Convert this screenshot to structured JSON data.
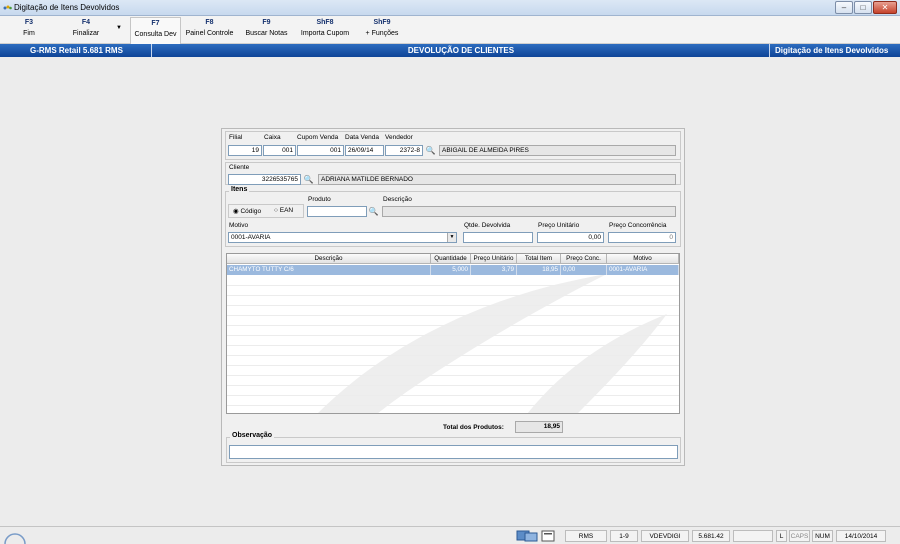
{
  "window": {
    "title": "Digitação de Itens Devolvidos",
    "minimize_glyph": "–",
    "maximize_glyph": "□",
    "close_glyph": "✕"
  },
  "toolbar": {
    "keys": [
      {
        "key": "F3",
        "label": "Fim"
      },
      {
        "key": "F4",
        "label": "Finalizar"
      },
      {
        "key": "F7",
        "label": "Consulta Dev"
      },
      {
        "key": "F8",
        "label": "Painel Controle"
      },
      {
        "key": "F9",
        "label": "Buscar Notas"
      },
      {
        "key": "ShF8",
        "label": "Importa Cupom"
      },
      {
        "key": "ShF9",
        "label": "+ Funções"
      }
    ]
  },
  "header": {
    "left": "G-RMS Retail 5.681 RMS",
    "center": "DEVOLUÇÃO DE CLIENTES",
    "right": "Digitação de Itens Devolvidos"
  },
  "sale": {
    "labels": {
      "filial": "Filial",
      "caixa": "Caixa",
      "cupom": "Cupom Venda",
      "data": "Data Venda",
      "vendedor": "Vendedor"
    },
    "filial": "19",
    "caixa": "001",
    "cupom": "001",
    "data": "26/09/14",
    "vendedor_code": "2372-8",
    "vendedor_name": "ABIGAIL DE ALMEIDA PIRES"
  },
  "client": {
    "label": "Cliente",
    "code": "3226535765",
    "name": "ADRIANA MATILDE BERNADO"
  },
  "items": {
    "title": "Itens",
    "radio_codigo": "Código",
    "radio_ean": "EAN",
    "produto_label": "Produto",
    "descricao_label": "Descrição",
    "produto_value": "",
    "descricao_value": "",
    "motivo_label": "Motivo",
    "motivo_value": "0001-AVARIA",
    "qtde_label": "Qtde. Devolvida",
    "qtde_value": "",
    "preco_label": "Preço Unitário",
    "preco_value": "0,00",
    "preco_conc_label": "Preço Concorrência",
    "preco_conc_value": "0"
  },
  "grid": {
    "columns": [
      "Descrição",
      "Quantidade",
      "Preço Unitário",
      "Total Item",
      "Preço Conc.",
      "Motivo"
    ],
    "rows": [
      [
        "CHAMYTO TUTTY C/6",
        "5,000",
        "3,79",
        "18,95",
        "0,00",
        "0001-AVARIA"
      ]
    ]
  },
  "totals": {
    "label": "Total dos Produtos:",
    "value": "18,95"
  },
  "observacao": {
    "label": "Observação",
    "value": ""
  },
  "statusbar": {
    "app": "RMS",
    "page": "1-9",
    "program": "VDEVDIGI",
    "version": "5.681.42",
    "l": "L",
    "caps": "CAPS",
    "num": "NUM",
    "date": "14/10/2014"
  },
  "colors": {
    "header_blue": "#0f4497",
    "selected_row": "#9bb9de",
    "fkey_text": "#14306d"
  }
}
